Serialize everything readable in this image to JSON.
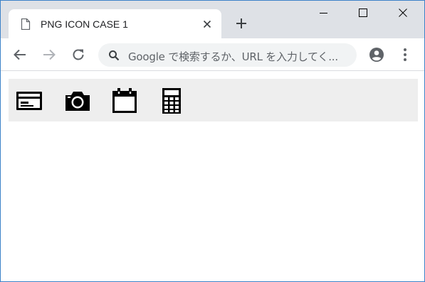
{
  "browser": {
    "tab": {
      "title": "PNG ICON CASE 1",
      "icon": "file-icon",
      "close_icon": "close-icon"
    },
    "new_tab_icon": "plus-icon",
    "window_controls": [
      "minimize-icon",
      "maximize-icon",
      "close-icon"
    ],
    "toolbar": {
      "back_icon": "arrow-back-icon",
      "forward_icon": "arrow-forward-icon",
      "reload_icon": "reload-icon",
      "omnibox": {
        "icon": "search-icon",
        "placeholder": "Google で検索するか、URL を入力してく..."
      },
      "profile_icon": "account-circle-icon",
      "menu_icon": "more-vert-icon"
    }
  },
  "page": {
    "icon_bar": {
      "background": "#eeeeee",
      "icons": [
        {
          "name": "credit-card-icon"
        },
        {
          "name": "camera-icon"
        },
        {
          "name": "calendar-icon"
        },
        {
          "name": "calculator-icon"
        }
      ]
    }
  },
  "colors": {
    "tabstrip": "#dee1e6",
    "omnibox": "#f1f3f4",
    "icon_color": "#000000",
    "toolbar_icon": "#5f6368",
    "window_border": "#3c82c8"
  }
}
